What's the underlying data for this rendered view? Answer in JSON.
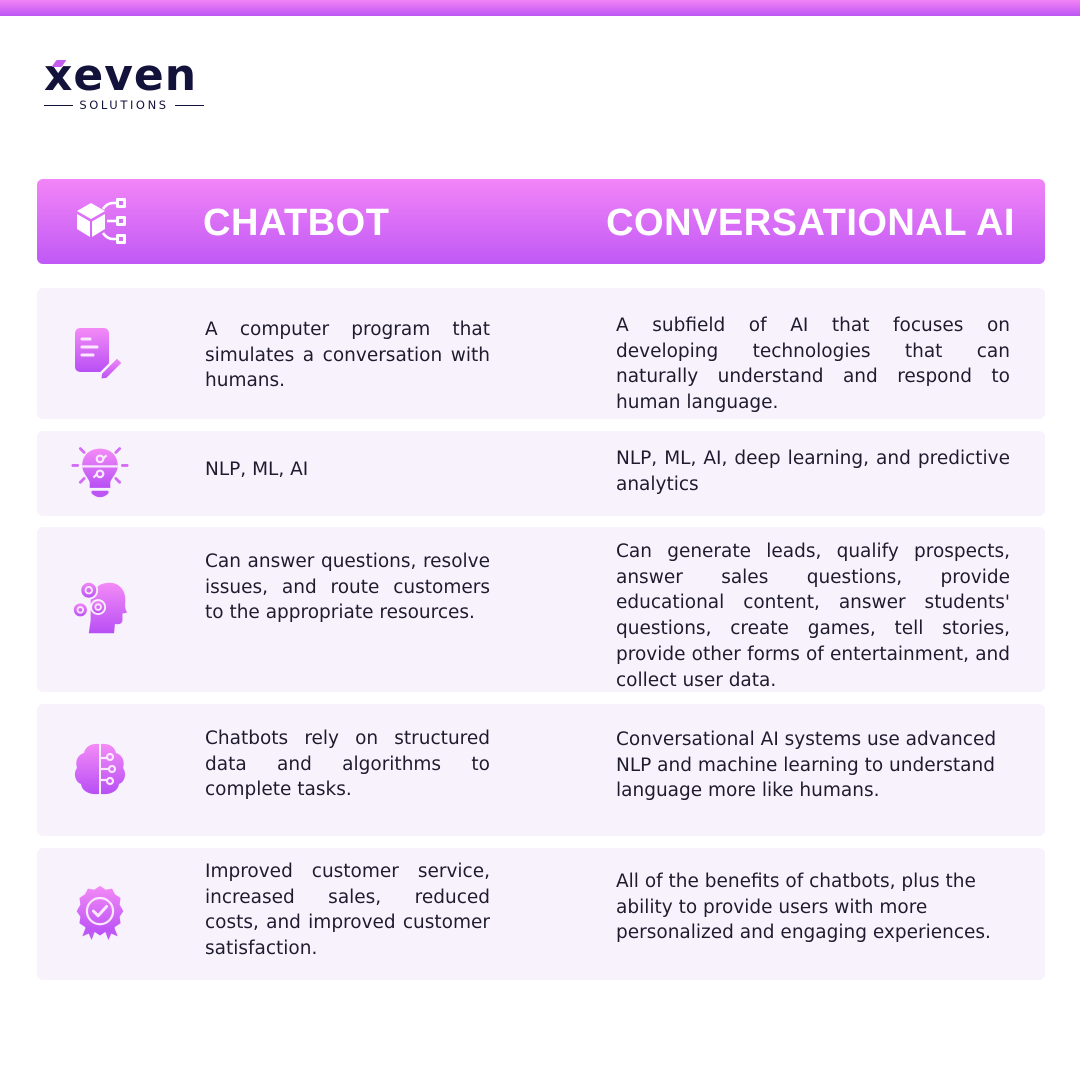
{
  "brand": {
    "name": "xeven",
    "tagline": "SOLUTIONS",
    "colors": {
      "accent_top": "#f385f7",
      "accent_bottom": "#c059f6",
      "row_bg": "#f8f2fd",
      "text": "#1e1b2e",
      "logo": "#13123a"
    }
  },
  "header": {
    "icon": "cube-network-icon",
    "col1_title": "CHATBOT",
    "col2_title": "CONVERSATIONAL AI"
  },
  "rows": [
    {
      "icon": "document-edit-icon",
      "chatbot": "A computer program that simulates a conversation with humans.",
      "conversational_ai": "A subfield of AI that focuses on developing technologies that can naturally understand and respond to human language."
    },
    {
      "icon": "lightbulb-circuit-icon",
      "chatbot": "NLP, ML, AI",
      "conversational_ai": "NLP, ML, AI, deep learning, and predictive analytics"
    },
    {
      "icon": "head-gears-icon",
      "chatbot": "Can answer questions, resolve issues, and route customers to the appropriate resources.",
      "conversational_ai": "Can generate leads, qualify prospects, answer sales questions, provide educational content, answer students' questions, create games, tell stories, provide other forms of entertainment, and collect user data."
    },
    {
      "icon": "brain-circuit-icon",
      "chatbot": "Chatbots rely on structured data and algorithms to complete tasks.",
      "conversational_ai": "Conversational AI systems use advanced NLP and machine learning to understand language more like humans."
    },
    {
      "icon": "award-badge-check-icon",
      "chatbot": "Improved customer service, increased sales, reduced costs, and improved customer satisfaction.",
      "conversational_ai": "All of the benefits of chatbots, plus the ability to provide users with more personalized and engaging experiences."
    }
  ]
}
